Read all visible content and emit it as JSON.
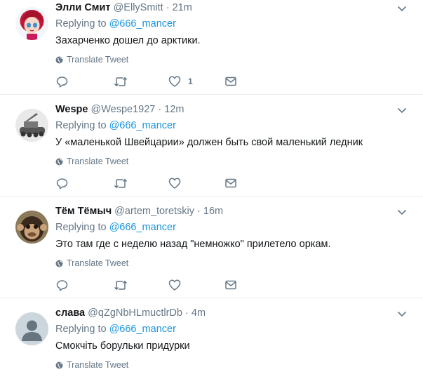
{
  "reply_prefix": "Replying to",
  "translate_label": "Translate Tweet",
  "tweets": [
    {
      "name": "Элли Смит",
      "handle": "@EllySmitt",
      "dot": "·",
      "time": "21m",
      "reply_to": "@666_mancer",
      "text": "Захарченко дошел до арктики.",
      "like_count": "1"
    },
    {
      "name": "Wespe",
      "handle": "@Wespe1927",
      "dot": "·",
      "time": "12m",
      "reply_to": "@666_mancer",
      "text": "У «маленькой Швейцарии» должен быть свой маленький ледник",
      "like_count": ""
    },
    {
      "name": "Тём Тёмыч",
      "handle": "@artem_toretskiy",
      "dot": "·",
      "time": "16m",
      "reply_to": "@666_mancer",
      "text": "Это там где с неделю назад \"немножко\" прилетело оркам.",
      "like_count": ""
    },
    {
      "name": "слава",
      "handle": "@qZgNbHLmuctlrDb",
      "dot": "·",
      "time": "4m",
      "reply_to": "@666_mancer",
      "text": "Смокчіть борульки придурки",
      "like_count": ""
    }
  ],
  "icons": {
    "reply": "reply-icon",
    "retweet": "retweet-icon",
    "like": "heart-icon",
    "dm": "envelope-icon",
    "globe": "globe-icon",
    "caret": "chevron-down-icon"
  },
  "colors": {
    "link": "#1b95e0",
    "secondary": "#657786",
    "text": "#14171a",
    "divider": "#e6ecf0"
  }
}
